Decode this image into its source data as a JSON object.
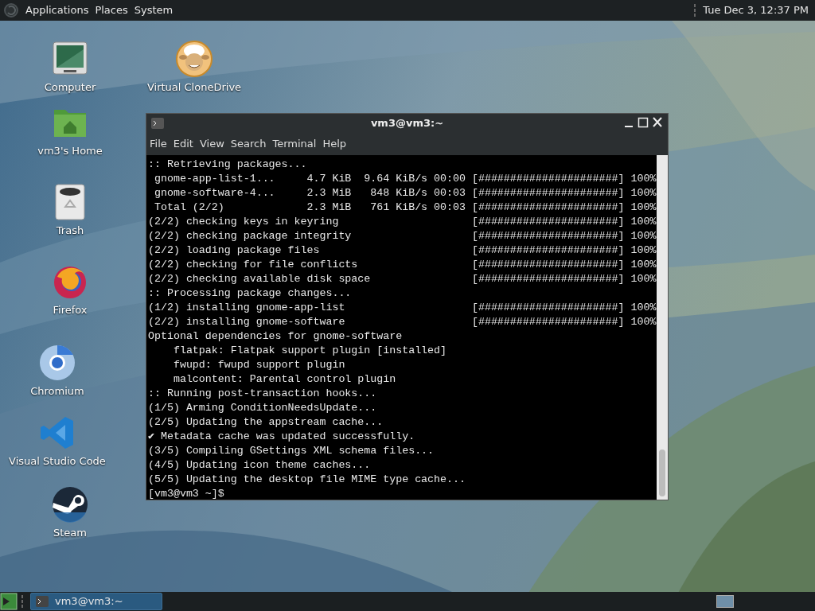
{
  "top_panel": {
    "menus": [
      "Applications",
      "Places",
      "System"
    ],
    "clock": "Tue Dec 3, 12:37 PM"
  },
  "desktop_icons": [
    {
      "label": "Computer",
      "kind": "computer"
    },
    {
      "label": "Virtual CloneDrive",
      "kind": "sheep"
    },
    {
      "label": "vm3's Home",
      "kind": "folder"
    },
    {
      "label": "Trash",
      "kind": "trash"
    },
    {
      "label": "Firefox",
      "kind": "firefox"
    },
    {
      "label": "Chromium",
      "kind": "chromium"
    },
    {
      "label": "Visual Studio Code",
      "kind": "vscode"
    },
    {
      "label": "Steam",
      "kind": "steam"
    }
  ],
  "terminal": {
    "title": "vm3@vm3:~",
    "menu": [
      "File",
      "Edit",
      "View",
      "Search",
      "Terminal",
      "Help"
    ],
    "lines": [
      ":: Retrieving packages...",
      " gnome-app-list-1...     4.7 KiB  9.64 KiB/s 00:00 [######################] 100%",
      " gnome-software-4...     2.3 MiB   848 KiB/s 00:03 [######################] 100%",
      " Total (2/2)             2.3 MiB   761 KiB/s 00:03 [######################] 100%",
      "(2/2) checking keys in keyring                     [######################] 100%",
      "(2/2) checking package integrity                   [######################] 100%",
      "(2/2) loading package files                        [######################] 100%",
      "(2/2) checking for file conflicts                  [######################] 100%",
      "(2/2) checking available disk space                [######################] 100%",
      ":: Processing package changes...",
      "(1/2) installing gnome-app-list                    [######################] 100%",
      "(2/2) installing gnome-software                    [######################] 100%",
      "Optional dependencies for gnome-software",
      "    flatpak: Flatpak support plugin [installed]",
      "    fwupd: fwupd support plugin",
      "    malcontent: Parental control plugin",
      ":: Running post-transaction hooks...",
      "(1/5) Arming ConditionNeedsUpdate...",
      "(2/5) Updating the appstream cache...",
      "✔ Metadata cache was updated successfully.",
      "(3/5) Compiling GSettings XML schema files...",
      "(4/5) Updating icon theme caches...",
      "(5/5) Updating the desktop file MIME type cache...",
      "[vm3@vm3 ~]$"
    ]
  },
  "taskbar": {
    "tasks": [
      {
        "label": "vm3@vm3:~",
        "selected": true
      }
    ]
  }
}
